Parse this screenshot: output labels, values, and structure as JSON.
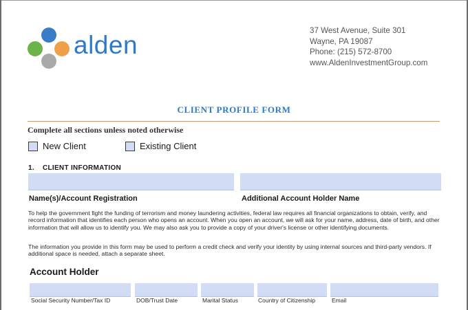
{
  "company": {
    "name": "alden",
    "colors": {
      "blue": "#3a7cc8",
      "green": "#6cb44a",
      "orange": "#f0a049",
      "gray": "#a9a9a9",
      "text": "#2f79c9"
    },
    "address_line1": "37 West Avenue, Suite 301",
    "address_line2": "Wayne, PA 19087",
    "phone": "Phone: (215) 572-8700",
    "website": "www.AldenInvestmentGroup.com"
  },
  "form": {
    "title": "CLIENT PROFILE FORM",
    "subtitle": "Complete all sections unless noted otherwise",
    "client_type_options": [
      "New Client",
      "Existing Client"
    ],
    "section1": {
      "number": "1.",
      "title": "CLIENT INFORMATION",
      "field_labels": [
        "Name(s)/Account Registration",
        "Additional Account Holder Name"
      ],
      "paragraph1": "To help the government fight the funding of terrorism and money laundering activities, federal law requires all financial organizations to obtain, verify, and record information that identifies each person who opens an account. When you open an account, we will ask for your name, address, date of birth, and other information that will allow us to identify you. We may also ask you to provide a copy of your driver's license or other identifying documents.",
      "paragraph2": "The information you provide in this form may be used to perform a credit check and verify your identity by using internal sources and third-party vendors. If additional space is needed, attach a separate sheet."
    },
    "account_holder": {
      "heading": "Account Holder",
      "field_labels": [
        "Social Security Number/Tax ID",
        "DOB/Trust Date",
        "Marital Status",
        "Country of Citizenship",
        "Email"
      ]
    }
  }
}
